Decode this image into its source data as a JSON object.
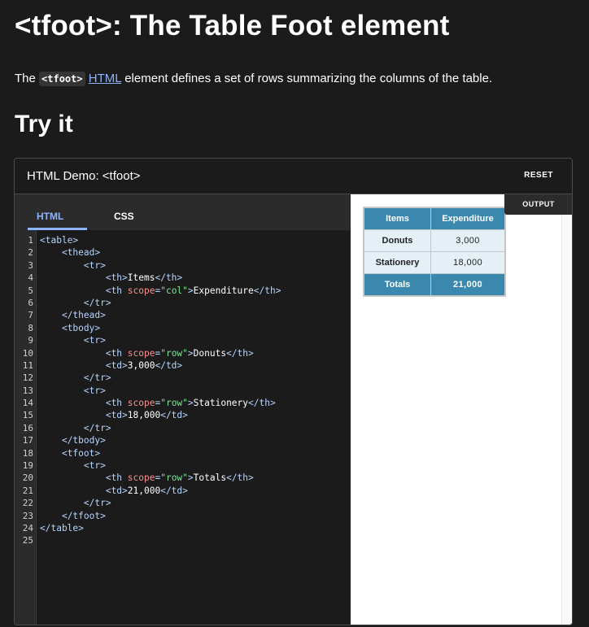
{
  "page": {
    "title": "<tfoot>: The Table Foot element",
    "intro_before": "The ",
    "intro_code": "<tfoot>",
    "intro_link": "HTML",
    "intro_after": " element defines a set of rows summarizing the columns of the table.",
    "section_heading": "Try it"
  },
  "demo": {
    "title": "HTML Demo: <tfoot>",
    "reset_label": "RESET",
    "tabs": [
      {
        "label": "HTML",
        "active": true
      },
      {
        "label": "CSS",
        "active": false
      }
    ],
    "output_label": "OUTPUT",
    "code_lines": [
      [
        [
          "tag",
          "<table>"
        ]
      ],
      [
        [
          "indent",
          "    "
        ],
        [
          "tag",
          "<thead>"
        ]
      ],
      [
        [
          "indent",
          "        "
        ],
        [
          "tag",
          "<tr>"
        ]
      ],
      [
        [
          "indent",
          "            "
        ],
        [
          "tag",
          "<th>"
        ],
        [
          "text",
          "Items"
        ],
        [
          "tag",
          "</th>"
        ]
      ],
      [
        [
          "indent",
          "            "
        ],
        [
          "tag",
          "<th "
        ],
        [
          "attr",
          "scope"
        ],
        [
          "tag",
          "="
        ],
        [
          "val",
          "\"col\""
        ],
        [
          "tag",
          ">"
        ],
        [
          "text",
          "Expenditure"
        ],
        [
          "tag",
          "</th>"
        ]
      ],
      [
        [
          "indent",
          "        "
        ],
        [
          "tag",
          "</tr>"
        ]
      ],
      [
        [
          "indent",
          "    "
        ],
        [
          "tag",
          "</thead>"
        ]
      ],
      [
        [
          "indent",
          "    "
        ],
        [
          "tag",
          "<tbody>"
        ]
      ],
      [
        [
          "indent",
          "        "
        ],
        [
          "tag",
          "<tr>"
        ]
      ],
      [
        [
          "indent",
          "            "
        ],
        [
          "tag",
          "<th "
        ],
        [
          "attr",
          "scope"
        ],
        [
          "tag",
          "="
        ],
        [
          "val",
          "\"row\""
        ],
        [
          "tag",
          ">"
        ],
        [
          "text",
          "Donuts"
        ],
        [
          "tag",
          "</th>"
        ]
      ],
      [
        [
          "indent",
          "            "
        ],
        [
          "tag",
          "<td>"
        ],
        [
          "text",
          "3,000"
        ],
        [
          "tag",
          "</td>"
        ]
      ],
      [
        [
          "indent",
          "        "
        ],
        [
          "tag",
          "</tr>"
        ]
      ],
      [
        [
          "indent",
          "        "
        ],
        [
          "tag",
          "<tr>"
        ]
      ],
      [
        [
          "indent",
          "            "
        ],
        [
          "tag",
          "<th "
        ],
        [
          "attr",
          "scope"
        ],
        [
          "tag",
          "="
        ],
        [
          "val",
          "\"row\""
        ],
        [
          "tag",
          ">"
        ],
        [
          "text",
          "Stationery"
        ],
        [
          "tag",
          "</th>"
        ]
      ],
      [
        [
          "indent",
          "            "
        ],
        [
          "tag",
          "<td>"
        ],
        [
          "text",
          "18,000"
        ],
        [
          "tag",
          "</td>"
        ]
      ],
      [
        [
          "indent",
          "        "
        ],
        [
          "tag",
          "</tr>"
        ]
      ],
      [
        [
          "indent",
          "    "
        ],
        [
          "tag",
          "</tbody>"
        ]
      ],
      [
        [
          "indent",
          "    "
        ],
        [
          "tag",
          "<tfoot>"
        ]
      ],
      [
        [
          "indent",
          "        "
        ],
        [
          "tag",
          "<tr>"
        ]
      ],
      [
        [
          "indent",
          "            "
        ],
        [
          "tag",
          "<th "
        ],
        [
          "attr",
          "scope"
        ],
        [
          "tag",
          "="
        ],
        [
          "val",
          "\"row\""
        ],
        [
          "tag",
          ">"
        ],
        [
          "text",
          "Totals"
        ],
        [
          "tag",
          "</th>"
        ]
      ],
      [
        [
          "indent",
          "            "
        ],
        [
          "tag",
          "<td>"
        ],
        [
          "text",
          "21,000"
        ],
        [
          "tag",
          "</td>"
        ]
      ],
      [
        [
          "indent",
          "        "
        ],
        [
          "tag",
          "</tr>"
        ]
      ],
      [
        [
          "indent",
          "    "
        ],
        [
          "tag",
          "</tfoot>"
        ]
      ],
      [
        [
          "tag",
          "</table>"
        ]
      ],
      []
    ]
  },
  "output_table": {
    "head": [
      "Items",
      "Expenditure"
    ],
    "body": [
      [
        "Donuts",
        "3,000"
      ],
      [
        "Stationery",
        "18,000"
      ]
    ],
    "foot": [
      "Totals",
      "21,000"
    ]
  },
  "colors": {
    "page_bg": "#1b1b1b",
    "link": "#8cb4ff",
    "table_header_bg": "#3a88ad",
    "table_body_bg": "#e4f0f5"
  }
}
